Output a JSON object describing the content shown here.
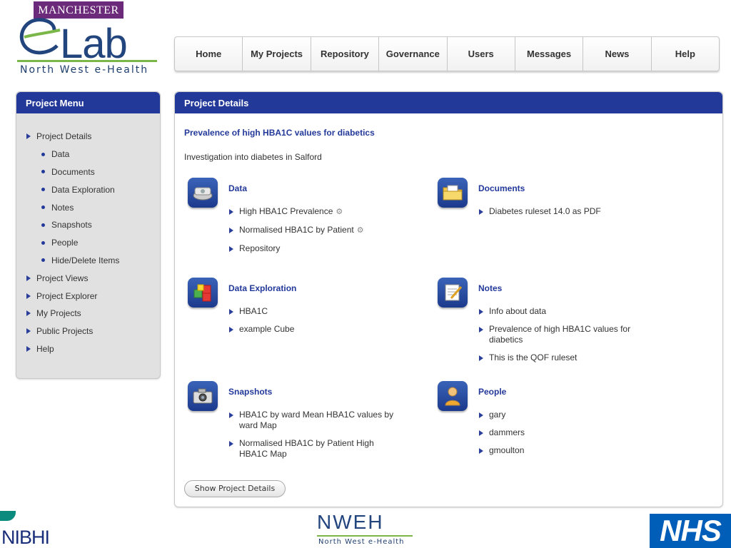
{
  "branding": {
    "university": "MANCHESTER",
    "app_logo_word": "Lab",
    "app_logo_sub": "North West e-Health"
  },
  "topnav": {
    "tabs": [
      "Home",
      "My Projects",
      "Repository",
      "Governance",
      "Users",
      "Messages",
      "News",
      "Help"
    ]
  },
  "sidebar": {
    "title": "Project Menu",
    "items": [
      {
        "label": "Project Details",
        "level": "top"
      },
      {
        "label": "Data",
        "level": "sub"
      },
      {
        "label": "Documents",
        "level": "sub"
      },
      {
        "label": "Data Exploration",
        "level": "sub"
      },
      {
        "label": "Notes",
        "level": "sub"
      },
      {
        "label": "Snapshots",
        "level": "sub"
      },
      {
        "label": "People",
        "level": "sub"
      },
      {
        "label": "Hide/Delete Items",
        "level": "sub"
      },
      {
        "label": "Project Views",
        "level": "top"
      },
      {
        "label": "Project Explorer",
        "level": "top"
      },
      {
        "label": "My Projects",
        "level": "top"
      },
      {
        "label": "Public Projects",
        "level": "top"
      },
      {
        "label": "Help",
        "level": "top"
      }
    ]
  },
  "main": {
    "panel_title": "Project Details",
    "project_title": "Prevalence of high HBA1C values for diabetics",
    "description": "Investigation into diabetes in Salford",
    "sections": {
      "data": {
        "title": "Data",
        "icon": "disk-drive-icon",
        "items": [
          "High HBA1C Prevalence",
          "Normalised HBA1C by Patient",
          "Repository"
        ]
      },
      "documents": {
        "title": "Documents",
        "icon": "folder-icon",
        "items": [
          "Diabetes ruleset 14.0 as PDF"
        ]
      },
      "exploration": {
        "title": "Data Exploration",
        "icon": "cubes-icon",
        "items": [
          "HBA1C",
          "example Cube"
        ]
      },
      "notes": {
        "title": "Notes",
        "icon": "notepad-icon",
        "items": [
          "Info about data",
          "Prevalence of high HBA1C values for diabetics",
          "This is the QOF ruleset"
        ]
      },
      "snapshots": {
        "title": "Snapshots",
        "icon": "camera-icon",
        "items": [
          "HBA1C by ward Mean HBA1C values by ward Map",
          "Normalised HBA1C by Patient High HBA1C Map"
        ]
      },
      "people": {
        "title": "People",
        "icon": "person-icon",
        "items": [
          "gary",
          "dammers",
          "gmoulton"
        ]
      }
    },
    "show_button": "Show Project Details"
  },
  "footer": {
    "left_logo": "NIBHI",
    "center_logo": "NWEH",
    "center_sub": "North West e-Health",
    "right_logo": "NHS"
  },
  "colors": {
    "accent": "#23399a",
    "panel_bg": "#e1e1e1",
    "logo_green": "#7ab648",
    "nhs_blue": "#005eb8"
  }
}
